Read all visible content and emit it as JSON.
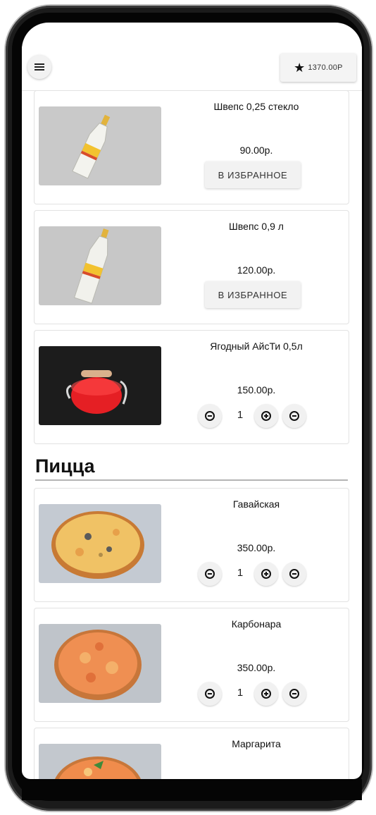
{
  "header": {
    "menu_icon": "hamburger-menu-icon",
    "favorites_icon": "star-icon",
    "favorites_total": "1370.00Р"
  },
  "products_top": [
    {
      "name": "Швепс 0,25 стекло",
      "price": "90.00р.",
      "action": "В ИЗБРАННОЕ"
    },
    {
      "name": "Швепс 0,9 л",
      "price": "120.00р.",
      "action": "В ИЗБРАННОЕ"
    },
    {
      "name": "Ягодный АйсТи 0,5л",
      "price": "150.00р.",
      "quantity": "1"
    }
  ],
  "pizza_section": {
    "title": "Пицца",
    "items": [
      {
        "name": "Гавайская",
        "price": "350.00р.",
        "quantity": "1"
      },
      {
        "name": "Карбонара",
        "price": "350.00р.",
        "quantity": "1"
      },
      {
        "name": "Маргарита"
      }
    ]
  },
  "stepper_icons": {
    "decrement": "minus-circle-icon",
    "increment": "plus-circle-icon",
    "remove": "remove-circle-icon"
  },
  "colors": {
    "background": "#ffffff",
    "frame": "#1b1b1b",
    "button_bg": "#f2f2f2",
    "text": "#111111"
  }
}
